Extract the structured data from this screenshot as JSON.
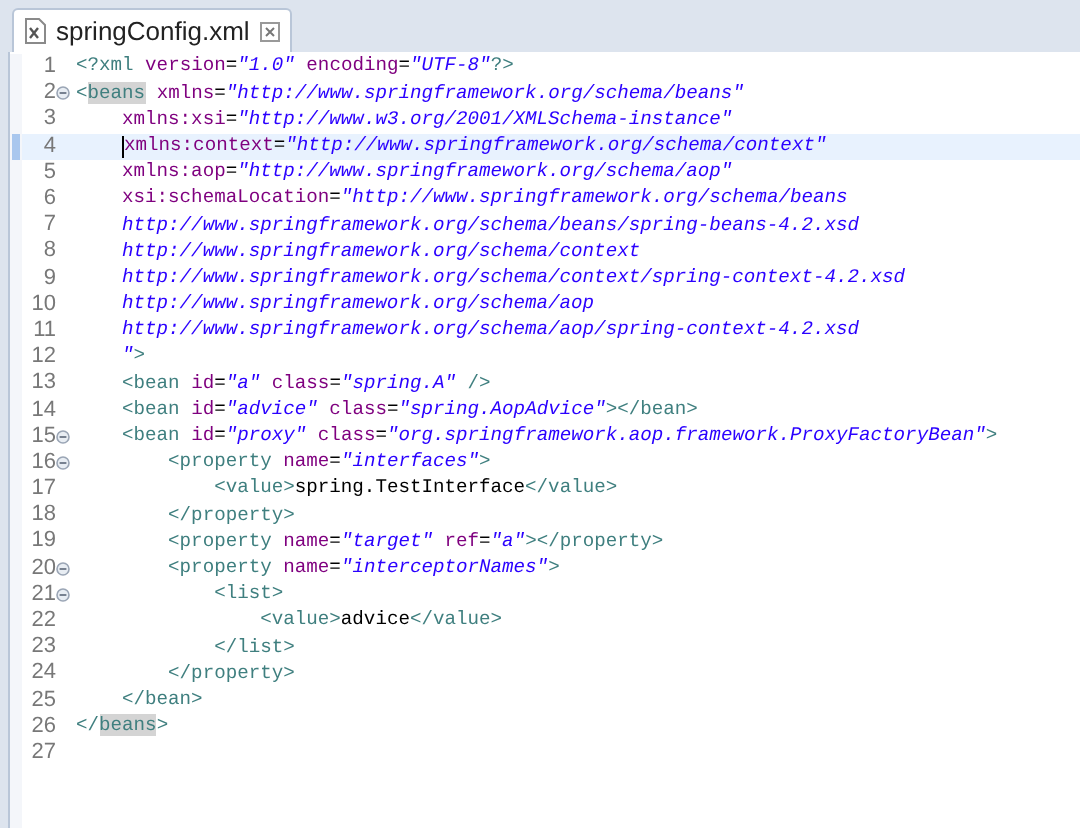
{
  "tab": {
    "title": "springConfig.xml",
    "selected": true
  },
  "lines": [
    {
      "number": "1",
      "segments": [
        {
          "kind": "tag",
          "text": "<?xml"
        },
        {
          "kind": "attr",
          "text": " version"
        },
        {
          "kind": "eq",
          "text": "="
        },
        {
          "kind": "str",
          "text": "\"1.0\""
        },
        {
          "kind": "attr",
          "text": " encoding"
        },
        {
          "kind": "eq",
          "text": "="
        },
        {
          "kind": "str",
          "text": "\"UTF-8\""
        },
        {
          "kind": "tag",
          "text": "?>"
        }
      ]
    },
    {
      "number": "2",
      "fold": true,
      "segments": [
        {
          "kind": "tag",
          "text": "<"
        },
        {
          "kind": "tag",
          "text": "beans",
          "highlight": true
        },
        {
          "kind": "attr",
          "text": " xmlns"
        },
        {
          "kind": "eq",
          "text": "="
        },
        {
          "kind": "str",
          "text": "\"http://www.springframework.org/schema/beans\""
        }
      ],
      "children": [
        {
          "number": "3",
          "segments": [
            {
              "kind": "attr",
              "text": "xmlns:xsi"
            },
            {
              "kind": "eq",
              "text": "="
            },
            {
              "kind": "str",
              "text": "\"http://www.w3.org/2001/XMLSchema-instance\""
            }
          ]
        },
        {
          "number": "4",
          "current": true,
          "segments": [
            {
              "kind": "attr",
              "text": "xmlns:context"
            },
            {
              "kind": "eq",
              "text": "="
            },
            {
              "kind": "str",
              "text": "\"http://www.springframework.org/schema/context\""
            }
          ]
        },
        {
          "number": "5",
          "segments": [
            {
              "kind": "attr",
              "text": "xmlns:aop"
            },
            {
              "kind": "eq",
              "text": "="
            },
            {
              "kind": "str",
              "text": "\"http://www.springframework.org/schema/aop\""
            }
          ]
        },
        {
          "number": "6",
          "segments": [
            {
              "kind": "attr",
              "text": "xsi:schemaLocation"
            },
            {
              "kind": "eq",
              "text": "="
            },
            {
              "kind": "str",
              "text": "\"http://www.springframework.org/schema/beans"
            }
          ]
        },
        {
          "number": "7",
          "segments": [
            {
              "kind": "str",
              "text": "http://www.springframework.org/schema/beans/spring-beans-4.2.xsd"
            }
          ]
        },
        {
          "number": "8",
          "segments": [
            {
              "kind": "str",
              "text": "http://www.springframework.org/schema/context"
            }
          ]
        },
        {
          "number": "9",
          "segments": [
            {
              "kind": "str",
              "text": "http://www.springframework.org/schema/context/spring-context-4.2.xsd"
            }
          ]
        },
        {
          "number": "10",
          "segments": [
            {
              "kind": "str",
              "text": "http://www.springframework.org/schema/aop"
            }
          ]
        },
        {
          "number": "11",
          "segments": [
            {
              "kind": "str",
              "text": "http://www.springframework.org/schema/aop/spring-context-4.2.xsd"
            }
          ]
        },
        {
          "number": "12",
          "segments": [
            {
              "kind": "str",
              "text": "\""
            },
            {
              "kind": "tag",
              "text": ">"
            }
          ]
        },
        {
          "number": "13",
          "segments": [
            {
              "kind": "tag",
              "text": "<bean"
            },
            {
              "kind": "attr",
              "text": " id"
            },
            {
              "kind": "eq",
              "text": "="
            },
            {
              "kind": "str",
              "text": "\"a\""
            },
            {
              "kind": "attr",
              "text": " class"
            },
            {
              "kind": "eq",
              "text": "="
            },
            {
              "kind": "str",
              "text": "\"spring.A\""
            },
            {
              "kind": "tag",
              "text": " />"
            }
          ]
        },
        {
          "number": "14",
          "segments": [
            {
              "kind": "tag",
              "text": "<bean"
            },
            {
              "kind": "attr",
              "text": " id"
            },
            {
              "kind": "eq",
              "text": "="
            },
            {
              "kind": "str",
              "text": "\"advice\""
            },
            {
              "kind": "attr",
              "text": " class"
            },
            {
              "kind": "eq",
              "text": "="
            },
            {
              "kind": "str",
              "text": "\"spring.AopAdvice\""
            },
            {
              "kind": "tag",
              "text": "></bean>"
            }
          ]
        },
        {
          "number": "15",
          "fold": true,
          "segments": [
            {
              "kind": "tag",
              "text": "<bean"
            },
            {
              "kind": "attr",
              "text": " id"
            },
            {
              "kind": "eq",
              "text": "="
            },
            {
              "kind": "str",
              "text": "\"proxy\""
            },
            {
              "kind": "attr",
              "text": " class"
            },
            {
              "kind": "eq",
              "text": "="
            },
            {
              "kind": "str",
              "text": "\"org.springframework.aop.framework.ProxyFactoryBean\""
            },
            {
              "kind": "tag",
              "text": ">"
            }
          ],
          "children": [
            {
              "number": "16",
              "fold": true,
              "segments": [
                {
                  "kind": "tag",
                  "text": "<property"
                },
                {
                  "kind": "attr",
                  "text": " name"
                },
                {
                  "kind": "eq",
                  "text": "="
                },
                {
                  "kind": "str",
                  "text": "\"interfaces\""
                },
                {
                  "kind": "tag",
                  "text": ">"
                }
              ],
              "children": [
                {
                  "number": "17",
                  "segments": [
                    {
                      "kind": "tag",
                      "text": "<value>"
                    },
                    {
                      "kind": "text",
                      "text": "spring.TestInterface"
                    },
                    {
                      "kind": "tag",
                      "text": "</value>"
                    }
                  ]
                }
              ]
            },
            {
              "number": "18",
              "segments": [
                {
                  "kind": "tag",
                  "text": "</property>"
                }
              ]
            },
            {
              "number": "19",
              "segments": [
                {
                  "kind": "tag",
                  "text": "<property"
                },
                {
                  "kind": "attr",
                  "text": " name"
                },
                {
                  "kind": "eq",
                  "text": "="
                },
                {
                  "kind": "str",
                  "text": "\"target\""
                },
                {
                  "kind": "attr",
                  "text": " ref"
                },
                {
                  "kind": "eq",
                  "text": "="
                },
                {
                  "kind": "str",
                  "text": "\"a\""
                },
                {
                  "kind": "tag",
                  "text": "></property>"
                }
              ]
            },
            {
              "number": "20",
              "fold": true,
              "segments": [
                {
                  "kind": "tag",
                  "text": "<property"
                },
                {
                  "kind": "attr",
                  "text": " name"
                },
                {
                  "kind": "eq",
                  "text": "="
                },
                {
                  "kind": "str",
                  "text": "\"interceptorNames\""
                },
                {
                  "kind": "tag",
                  "text": ">"
                }
              ],
              "children": [
                {
                  "number": "21",
                  "fold": true,
                  "segments": [
                    {
                      "kind": "tag",
                      "text": "<list>"
                    }
                  ],
                  "children": [
                    {
                      "number": "22",
                      "segments": [
                        {
                          "kind": "tag",
                          "text": "<value>"
                        },
                        {
                          "kind": "text",
                          "text": "advice"
                        },
                        {
                          "kind": "tag",
                          "text": "</value>"
                        }
                      ]
                    }
                  ]
                },
                {
                  "number": "23",
                  "segments": [
                    {
                      "kind": "tag",
                      "text": "</list>"
                    }
                  ]
                }
              ]
            },
            {
              "number": "24",
              "segments": [
                {
                  "kind": "tag",
                  "text": "</property>"
                }
              ]
            }
          ]
        },
        {
          "number": "25",
          "segments": [
            {
              "kind": "tag",
              "text": "</bean>"
            }
          ]
        }
      ]
    },
    {
      "number": "26",
      "segments": [
        {
          "kind": "tag",
          "text": "</"
        },
        {
          "kind": "tag",
          "text": "beans",
          "highlight": true
        },
        {
          "kind": "tag",
          "text": ">"
        }
      ]
    },
    {
      "number": "27"
    }
  ]
}
